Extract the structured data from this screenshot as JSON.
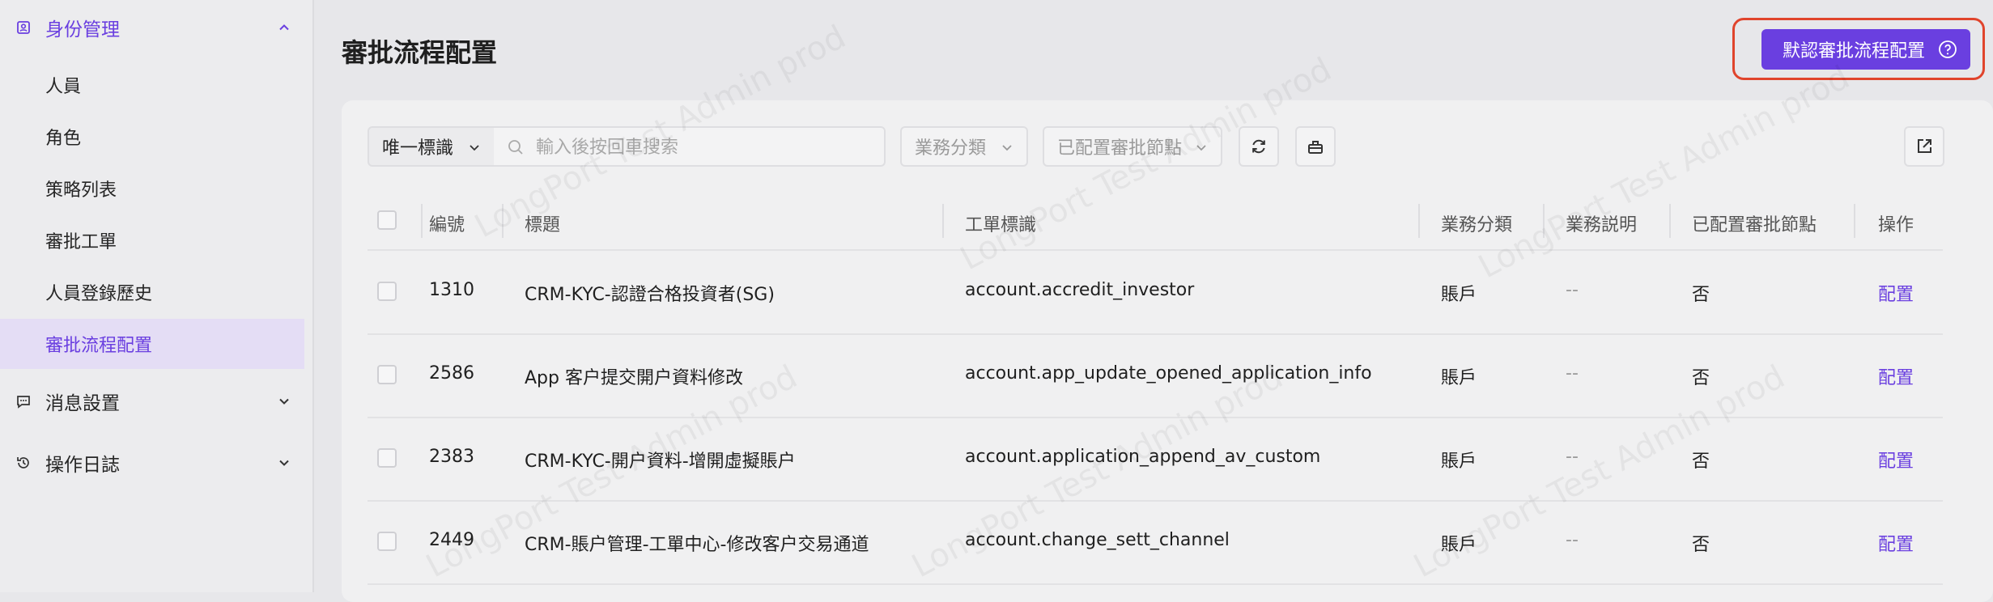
{
  "sidebar": {
    "groups": [
      {
        "label": "身份管理",
        "expanded": true
      },
      {
        "label": "消息設置",
        "expanded": false
      },
      {
        "label": "操作日誌",
        "expanded": false
      }
    ],
    "items": [
      {
        "label": "人員"
      },
      {
        "label": "角色"
      },
      {
        "label": "策略列表"
      },
      {
        "label": "審批工單"
      },
      {
        "label": "人員登錄歷史"
      },
      {
        "label": "審批流程配置",
        "selected": true
      }
    ]
  },
  "header": {
    "title": "審批流程配置",
    "primary_button": "默認審批流程配置"
  },
  "filters": {
    "key_select": "唯一標識",
    "search_placeholder": "輸入後按回車搜索",
    "category_select": "業務分類",
    "node_select": "已配置審批節點"
  },
  "table": {
    "columns": [
      "編號",
      "標題",
      "工單標識",
      "業務分類",
      "業務説明",
      "已配置審批節點",
      "操作"
    ],
    "rows": [
      {
        "id": "1310",
        "title": "CRM-KYC-認證合格投資者(SG)",
        "key": "account.accredit_investor",
        "category": "賬戶",
        "desc": "--",
        "configured": "否",
        "action": "配置"
      },
      {
        "id": "2586",
        "title": "App 客户提交開户資料修改",
        "key": "account.app_update_opened_application_info",
        "category": "賬戶",
        "desc": "--",
        "configured": "否",
        "action": "配置"
      },
      {
        "id": "2383",
        "title": "CRM-KYC-開户資料-增開虛擬賬户",
        "key": "account.application_append_av_custom",
        "category": "賬戶",
        "desc": "--",
        "configured": "否",
        "action": "配置"
      },
      {
        "id": "2449",
        "title": "CRM-賬户管理-工單中心-修改客户交易通道",
        "key": "account.change_sett_channel",
        "category": "賬戶",
        "desc": "--",
        "configured": "否",
        "action": "配置"
      }
    ]
  },
  "watermark": "LongPort Test Admin prod",
  "colors": {
    "accent": "#6a3fe0",
    "highlight": "#e0442c"
  }
}
